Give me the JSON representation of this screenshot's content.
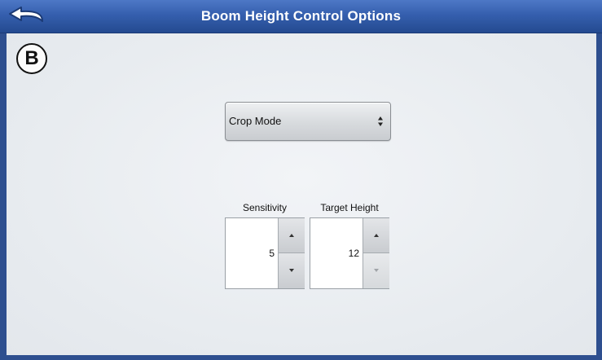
{
  "header": {
    "title": "Boom Height Control Options",
    "back_icon": "back-arrow-icon"
  },
  "badge": {
    "letter": "B"
  },
  "mode_select": {
    "selected": "Crop Mode",
    "icon": "up-down-arrows-icon"
  },
  "sensitivity": {
    "label": "Sensitivity",
    "value": "5"
  },
  "target_height": {
    "label": "Target Height",
    "value": "12"
  },
  "colors": {
    "titlebar": "#355fae",
    "content_bg": "#eaeef2",
    "frame": "#2e4f8f"
  }
}
